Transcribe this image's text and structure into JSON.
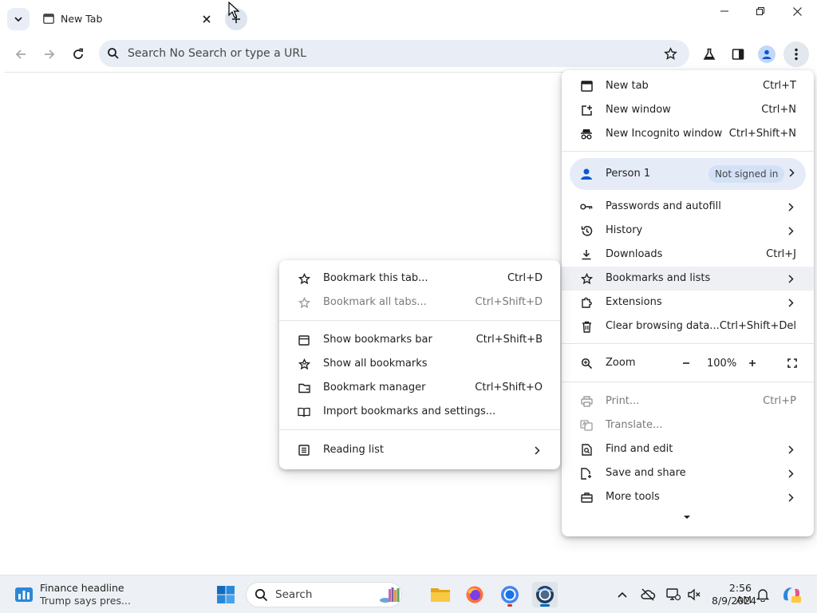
{
  "tab": {
    "title": "New Tab"
  },
  "omnibox": {
    "placeholder": "Search No Search or type a URL"
  },
  "menu": {
    "new_tab": {
      "label": "New tab",
      "shortcut": "Ctrl+T"
    },
    "new_window": {
      "label": "New window",
      "shortcut": "Ctrl+N"
    },
    "new_incognito": {
      "label": "New Incognito window",
      "shortcut": "Ctrl+Shift+N"
    },
    "profile": {
      "name": "Person 1",
      "status": "Not signed in"
    },
    "passwords": {
      "label": "Passwords and autofill"
    },
    "history": {
      "label": "History"
    },
    "downloads": {
      "label": "Downloads",
      "shortcut": "Ctrl+J"
    },
    "bookmarks": {
      "label": "Bookmarks and lists"
    },
    "extensions": {
      "label": "Extensions"
    },
    "clear_data": {
      "label": "Clear browsing data...",
      "shortcut": "Ctrl+Shift+Del"
    },
    "zoom": {
      "label": "Zoom",
      "value": "100%",
      "minus": "−",
      "plus": "+"
    },
    "print": {
      "label": "Print...",
      "shortcut": "Ctrl+P"
    },
    "translate": {
      "label": "Translate..."
    },
    "find_edit": {
      "label": "Find and edit"
    },
    "save_share": {
      "label": "Save and share"
    },
    "more_tools": {
      "label": "More tools"
    }
  },
  "bookmarks_menu": {
    "bookmark_tab": {
      "label": "Bookmark this tab...",
      "shortcut": "Ctrl+D"
    },
    "bookmark_all": {
      "label": "Bookmark all tabs...",
      "shortcut": "Ctrl+Shift+D"
    },
    "show_bar": {
      "label": "Show bookmarks bar",
      "shortcut": "Ctrl+Shift+B"
    },
    "show_all": {
      "label": "Show all bookmarks"
    },
    "manager": {
      "label": "Bookmark manager",
      "shortcut": "Ctrl+Shift+O"
    },
    "import": {
      "label": "Import bookmarks and settings..."
    },
    "reading_list": {
      "label": "Reading list"
    }
  },
  "taskbar": {
    "news_title": "Finance headline",
    "news_sub": "Trump says pres...",
    "search_label": "Search",
    "time": "2:56 AM",
    "date": "8/9/2024"
  },
  "colors": {
    "accent": "#0b57d0",
    "menu_highlight": "#eef0f3",
    "profile_bg": "#e6ecf7"
  }
}
